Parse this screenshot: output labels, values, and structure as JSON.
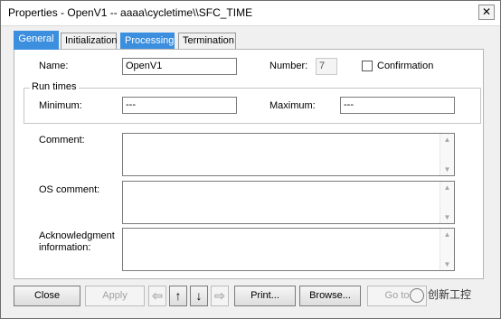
{
  "window": {
    "title": "Properties -  OpenV1 -- aaaa\\cycletime\\\\SFC_TIME",
    "close_glyph": "✕"
  },
  "tabs": [
    {
      "label": "General"
    },
    {
      "label": "Initialization"
    },
    {
      "label": "Processing"
    },
    {
      "label": "Termination"
    }
  ],
  "general": {
    "name_label": "Name:",
    "name_value": "OpenV1",
    "number_label": "Number:",
    "number_value": "7",
    "confirmation_label": "Confirmation",
    "runtimes_title": "Run times",
    "minimum_label": "Minimum:",
    "minimum_value": "---",
    "maximum_label": "Maximum:",
    "maximum_value": "---",
    "comment_label": "Comment:",
    "os_comment_label": "OS comment:",
    "ack_label_line1": "Acknowledgment",
    "ack_label_line2": "information:"
  },
  "buttons": {
    "close": "Close",
    "apply": "Apply",
    "print": "Print...",
    "browse": "Browse...",
    "goto": "Go to"
  },
  "arrows": {
    "left": "⇦",
    "up": "↑",
    "down": "↓",
    "right": "⇨"
  },
  "scroll_glyphs": {
    "up": "▲",
    "down": "▼"
  },
  "watermark": {
    "text": "创新工控"
  },
  "colors": {
    "tab_active": "#3c8fde"
  }
}
